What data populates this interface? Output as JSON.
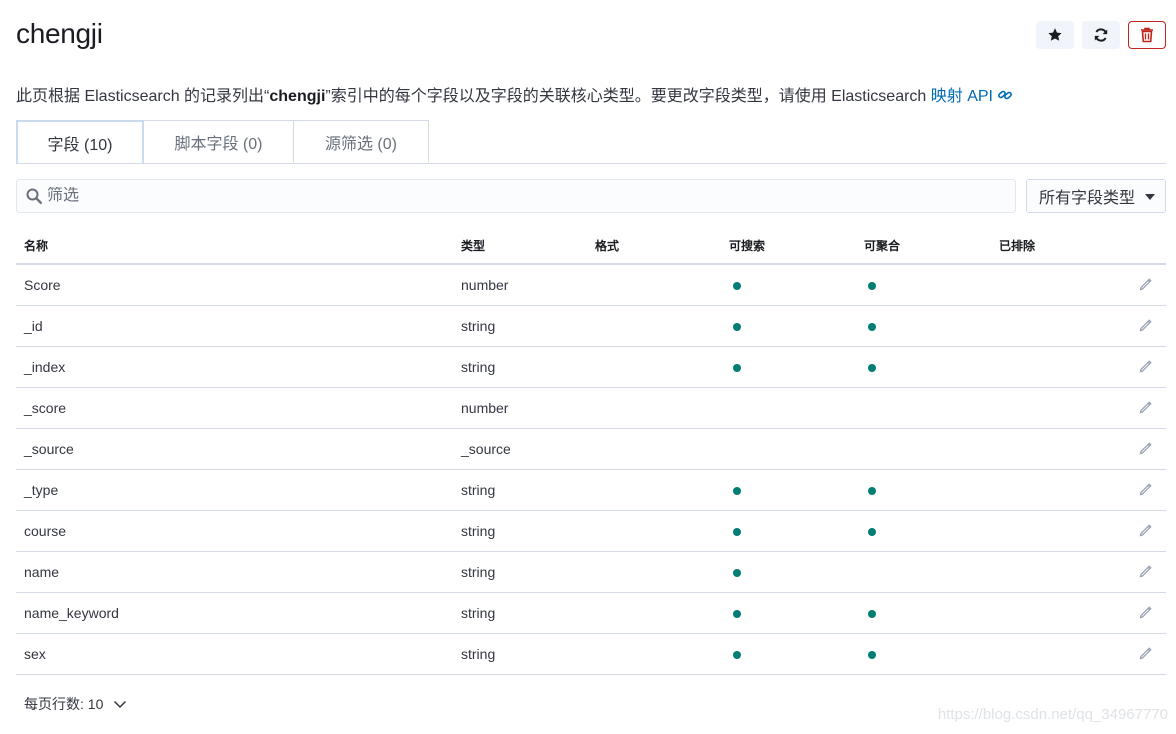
{
  "header": {
    "title": "chengji"
  },
  "description": {
    "prefix": "此页根据 Elasticsearch 的记录列出“",
    "index_name": "chengji",
    "suffix": "”索引中的每个字段以及字段的关联核心类型。要更改字段类型，请使用 Elasticsearch ",
    "link_text": "映射 API"
  },
  "tabs": [
    {
      "label": "字段 (10)"
    },
    {
      "label": "脚本字段 (0)"
    },
    {
      "label": "源筛选 (0)"
    }
  ],
  "filter": {
    "placeholder": "筛选",
    "value": ""
  },
  "type_filter": {
    "selected": "所有字段类型"
  },
  "table": {
    "headers": [
      "名称",
      "类型",
      "格式",
      "可搜索",
      "可聚合",
      "已排除"
    ],
    "rows": [
      {
        "name": "Score",
        "type": "number",
        "format": "",
        "searchable": true,
        "aggregatable": true,
        "excluded": false
      },
      {
        "name": "_id",
        "type": "string",
        "format": "",
        "searchable": true,
        "aggregatable": true,
        "excluded": false
      },
      {
        "name": "_index",
        "type": "string",
        "format": "",
        "searchable": true,
        "aggregatable": true,
        "excluded": false
      },
      {
        "name": "_score",
        "type": "number",
        "format": "",
        "searchable": false,
        "aggregatable": false,
        "excluded": false
      },
      {
        "name": "_source",
        "type": "_source",
        "format": "",
        "searchable": false,
        "aggregatable": false,
        "excluded": false
      },
      {
        "name": "_type",
        "type": "string",
        "format": "",
        "searchable": true,
        "aggregatable": true,
        "excluded": false
      },
      {
        "name": "course",
        "type": "string",
        "format": "",
        "searchable": true,
        "aggregatable": true,
        "excluded": false
      },
      {
        "name": "name",
        "type": "string",
        "format": "",
        "searchable": true,
        "aggregatable": false,
        "excluded": false
      },
      {
        "name": "name_keyword",
        "type": "string",
        "format": "",
        "searchable": true,
        "aggregatable": true,
        "excluded": false
      },
      {
        "name": "sex",
        "type": "string",
        "format": "",
        "searchable": true,
        "aggregatable": true,
        "excluded": false
      }
    ]
  },
  "pagination": {
    "rows_per_page_label": "每页行数: 10"
  },
  "watermark": "https://blog.csdn.net/qq_34967770",
  "colors": {
    "accent": "#006bb4",
    "dot": "#017d73",
    "danger": "#bd271e"
  },
  "icons": {
    "favorite": "star-icon",
    "refresh": "refresh-icon",
    "delete": "trash-icon",
    "link": "link-icon",
    "search": "search-icon",
    "edit": "pencil-icon",
    "chevron": "chevron-down-icon"
  }
}
